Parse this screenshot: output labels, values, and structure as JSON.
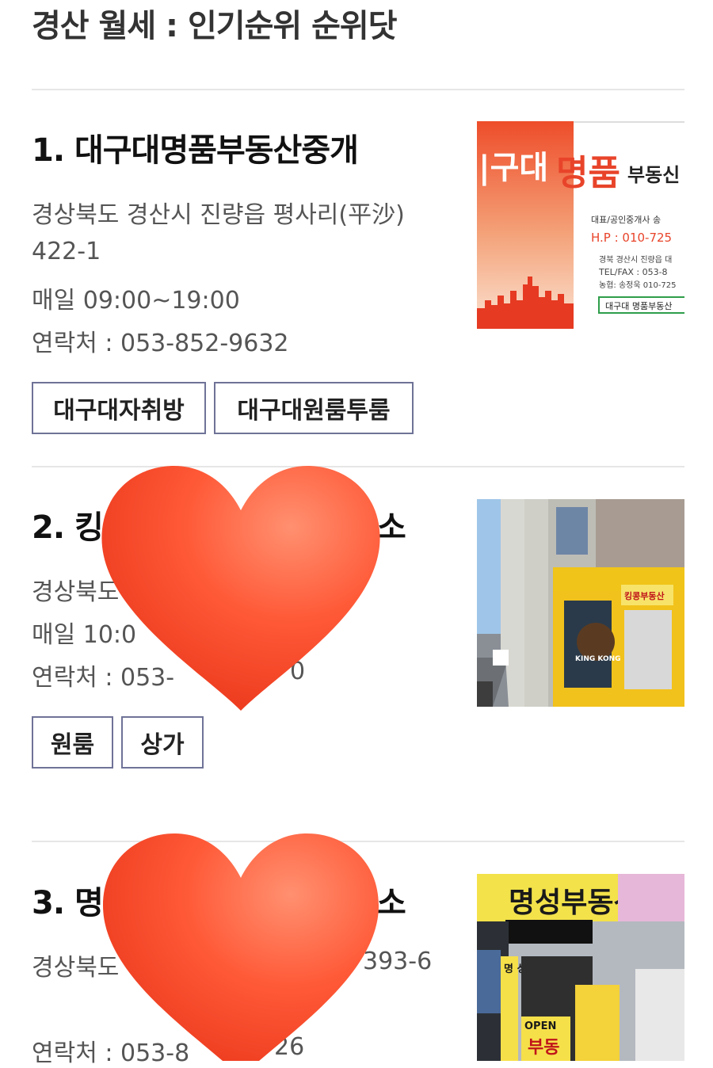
{
  "page": {
    "title": "경산 월세 : 인기순위 순위닷"
  },
  "items": [
    {
      "title": "1. 대구대명품부동산중개",
      "address_line1": "경상북도 경산시 진량읍 평사리(平沙)",
      "address_line2": "422-1",
      "hours": "매일 09:00~19:00",
      "phone": "연락처 : 053-852-9632",
      "tags": [
        "대구대자취방",
        "대구대원룸투룸"
      ],
      "image": {
        "left_text": "|구대",
        "brand": "명품",
        "brand_tail": "부동신",
        "rep": "대표/공인중개사 송",
        "hp": "H.P : 010-725",
        "addr": "경북 경산시 진량읍 대",
        "fax": "TEL/FAX : 053-8",
        "bank": "농협: 송정욱 010-725",
        "badge": "대구대 명품부동산",
        "accent": "#e8442a"
      }
    },
    {
      "title_start": "2. 킹",
      "title_end": "소",
      "address": "경상북도",
      "hours": "매일 10:0",
      "phone_start": "연락처 : 053-",
      "phone_end": "0",
      "tags": [
        "원룸",
        "상가"
      ],
      "image": {
        "sign1": "KING KONG",
        "sign2": "킹콩부동산"
      }
    },
    {
      "title_start": "3. 명",
      "title_end": "소",
      "address_start": "경상북도",
      "address_end": "393-6",
      "phone_start": "연락처 : 053-8",
      "phone_end": "26",
      "image": {
        "top_sign": "명성부동산",
        "open": "OPEN",
        "vertical": "명 성 부 동",
        "bu": "부동"
      }
    }
  ],
  "overlay": {
    "heart_color": "#ff4a2e"
  }
}
